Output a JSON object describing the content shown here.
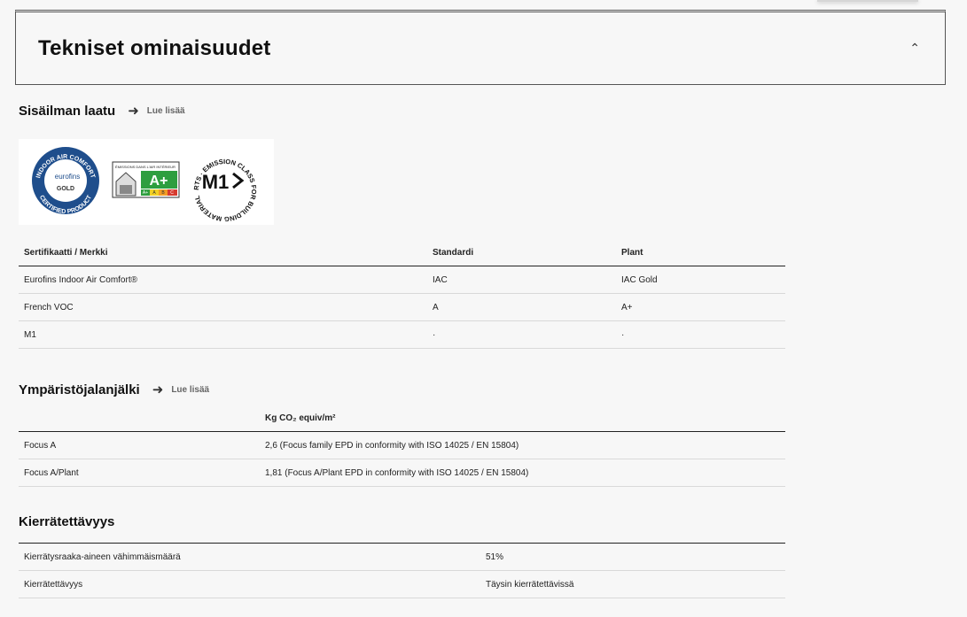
{
  "panel": {
    "title": "Tekniset ominaisuudet",
    "collapse_icon": "chevron-up-icon"
  },
  "iaq": {
    "title": "Sisäilman laatu",
    "read_more": "Lue lisää",
    "badges": {
      "indoor_air_comfort": {
        "ring_text": "INDOOR AIR COMFORT",
        "brand": "eurofins",
        "level": "GOLD",
        "bottom_text": "CERTIFIED PRODUCT"
      },
      "french_voc": {
        "header": "ÉMISSIONS DANS L'AIR INTÉRIEUR",
        "grade": "A+",
        "scale": [
          "A+",
          "A",
          "B",
          "C"
        ]
      },
      "m1": {
        "ring_text": "RTS · EMISSION CLASS FOR BUILDING MATERIAL",
        "label": "M1"
      }
    },
    "table": {
      "headers": [
        "Sertifikaatti / Merkki",
        "Standardi",
        "Plant"
      ],
      "rows": [
        [
          "Eurofins Indoor Air Comfort®",
          "IAC",
          "IAC Gold"
        ],
        [
          "French VOC",
          "A",
          "A+"
        ],
        [
          "M1",
          "·",
          "·"
        ]
      ]
    }
  },
  "env": {
    "title": "Ympäristöjalanjälki",
    "read_more": "Lue lisää",
    "table": {
      "headers": [
        "",
        "Kg CO₂ equiv/m²"
      ],
      "rows": [
        [
          "Focus A",
          "2,6 (Focus family EPD in conformity with ISO 14025 / EN 15804)"
        ],
        [
          "Focus A/Plant",
          "1,81 (Focus A/Plant EPD in conformity with ISO 14025 / EN 15804)"
        ]
      ]
    }
  },
  "recycle": {
    "title": "Kierrätettävyys",
    "table": {
      "rows": [
        [
          "Kierrätysraaka-aineen vähimmäismäärä",
          "51%"
        ],
        [
          "Kierrätettävyys",
          "Täysin kierrätettävissä"
        ]
      ]
    }
  },
  "colors": {
    "badge_blue": "#1f4e8c",
    "voc_green": "#2e9e3f",
    "background": "#f7f7f7"
  }
}
